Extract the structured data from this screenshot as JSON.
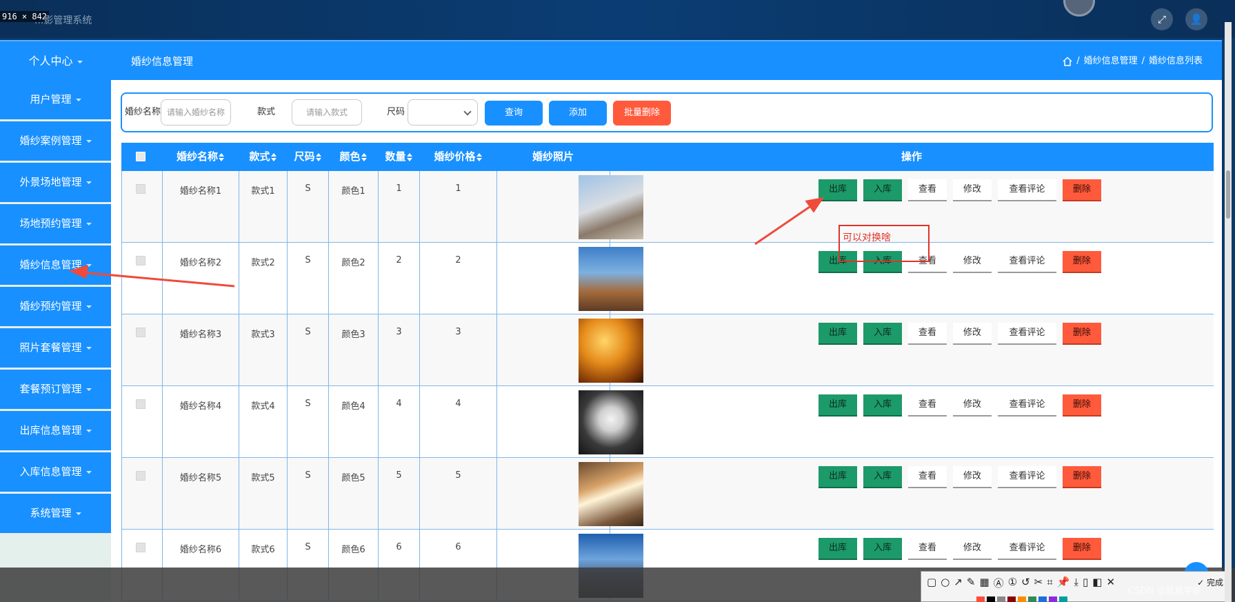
{
  "screen": {
    "dimension_label": "916 × 842",
    "system_title": "...影管理系统"
  },
  "header": {
    "menu_top": "个人中心",
    "page_title": "婚纱信息管理",
    "breadcrumbs": [
      "婚纱信息管理",
      "婚纱信息列表"
    ]
  },
  "sidebar": {
    "items": [
      {
        "label": "用户管理"
      },
      {
        "label": "婚纱案例管理"
      },
      {
        "label": "外景场地管理"
      },
      {
        "label": "场地预约管理"
      },
      {
        "label": "婚纱信息管理"
      },
      {
        "label": "婚纱预约管理"
      },
      {
        "label": "照片套餐管理"
      },
      {
        "label": "套餐预订管理"
      },
      {
        "label": "出库信息管理"
      },
      {
        "label": "入库信息管理"
      },
      {
        "label": "系统管理"
      }
    ]
  },
  "search": {
    "name_label": "婚纱名称",
    "name_placeholder": "请输入婚纱名称",
    "style_label": "款式",
    "style_placeholder": "请输入款式",
    "size_label": "尺码",
    "size_value": "",
    "query_btn": "查询",
    "add_btn": "添加",
    "batch_delete_btn": "批量删除"
  },
  "table": {
    "headers": {
      "name": "婚纱名称",
      "style": "款式",
      "size": "尺码",
      "color": "颜色",
      "qty": "数量",
      "price": "婚纱价格",
      "photo": "婚纱照片",
      "ops": "操作"
    },
    "op_labels": {
      "out": "出库",
      "in": "入库",
      "view": "查看",
      "edit": "修改",
      "comments": "查看评论",
      "delete": "删除"
    },
    "rows": [
      {
        "name": "婚纱名称1",
        "style": "款式1",
        "size": "S",
        "color": "颜色1",
        "qty": "1",
        "price": "1"
      },
      {
        "name": "婚纱名称2",
        "style": "款式2",
        "size": "S",
        "color": "颜色2",
        "qty": "2",
        "price": "2"
      },
      {
        "name": "婚纱名称3",
        "style": "款式3",
        "size": "S",
        "color": "颜色3",
        "qty": "3",
        "price": "3"
      },
      {
        "name": "婚纱名称4",
        "style": "款式4",
        "size": "S",
        "color": "颜色4",
        "qty": "4",
        "price": "4"
      },
      {
        "name": "婚纱名称5",
        "style": "款式5",
        "size": "S",
        "color": "颜色5",
        "qty": "5",
        "price": "5"
      },
      {
        "name": "婚纱名称6",
        "style": "款式6",
        "size": "S",
        "color": "颜色6",
        "qty": "6",
        "price": "6"
      }
    ]
  },
  "annotation": {
    "text": "可以对换啥"
  },
  "screenshot_toolbar": {
    "done_label": "完成"
  },
  "watermark": "CSDN @其其学姐",
  "colors": {
    "primary": "#1890ff",
    "danger": "#ff5a3c",
    "green": "#1c9a6a",
    "annotation": "#e0322a"
  }
}
